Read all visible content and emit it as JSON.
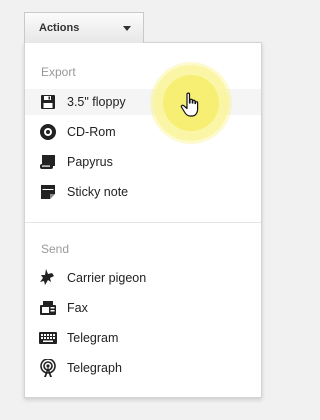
{
  "toolbar": {
    "actions_label": "Actions"
  },
  "menu": {
    "export": {
      "label": "Export",
      "items": [
        {
          "label": "3.5\" floppy",
          "icon": "floppy-disk-icon"
        },
        {
          "label": "CD-Rom",
          "icon": "cd-rom-icon"
        },
        {
          "label": "Papyrus",
          "icon": "scroll-icon"
        },
        {
          "label": "Sticky note",
          "icon": "sticky-note-icon"
        }
      ]
    },
    "send": {
      "label": "Send",
      "items": [
        {
          "label": "Carrier pigeon",
          "icon": "pigeon-icon"
        },
        {
          "label": "Fax",
          "icon": "fax-icon"
        },
        {
          "label": "Telegram",
          "icon": "keyboard-icon"
        },
        {
          "label": "Telegraph",
          "icon": "antenna-icon"
        }
      ]
    },
    "hovered_item": "3.5\" floppy"
  },
  "colors": {
    "highlight": "#f5ee6e",
    "hover_row": "#f5f5f5",
    "section_label": "#999999"
  }
}
